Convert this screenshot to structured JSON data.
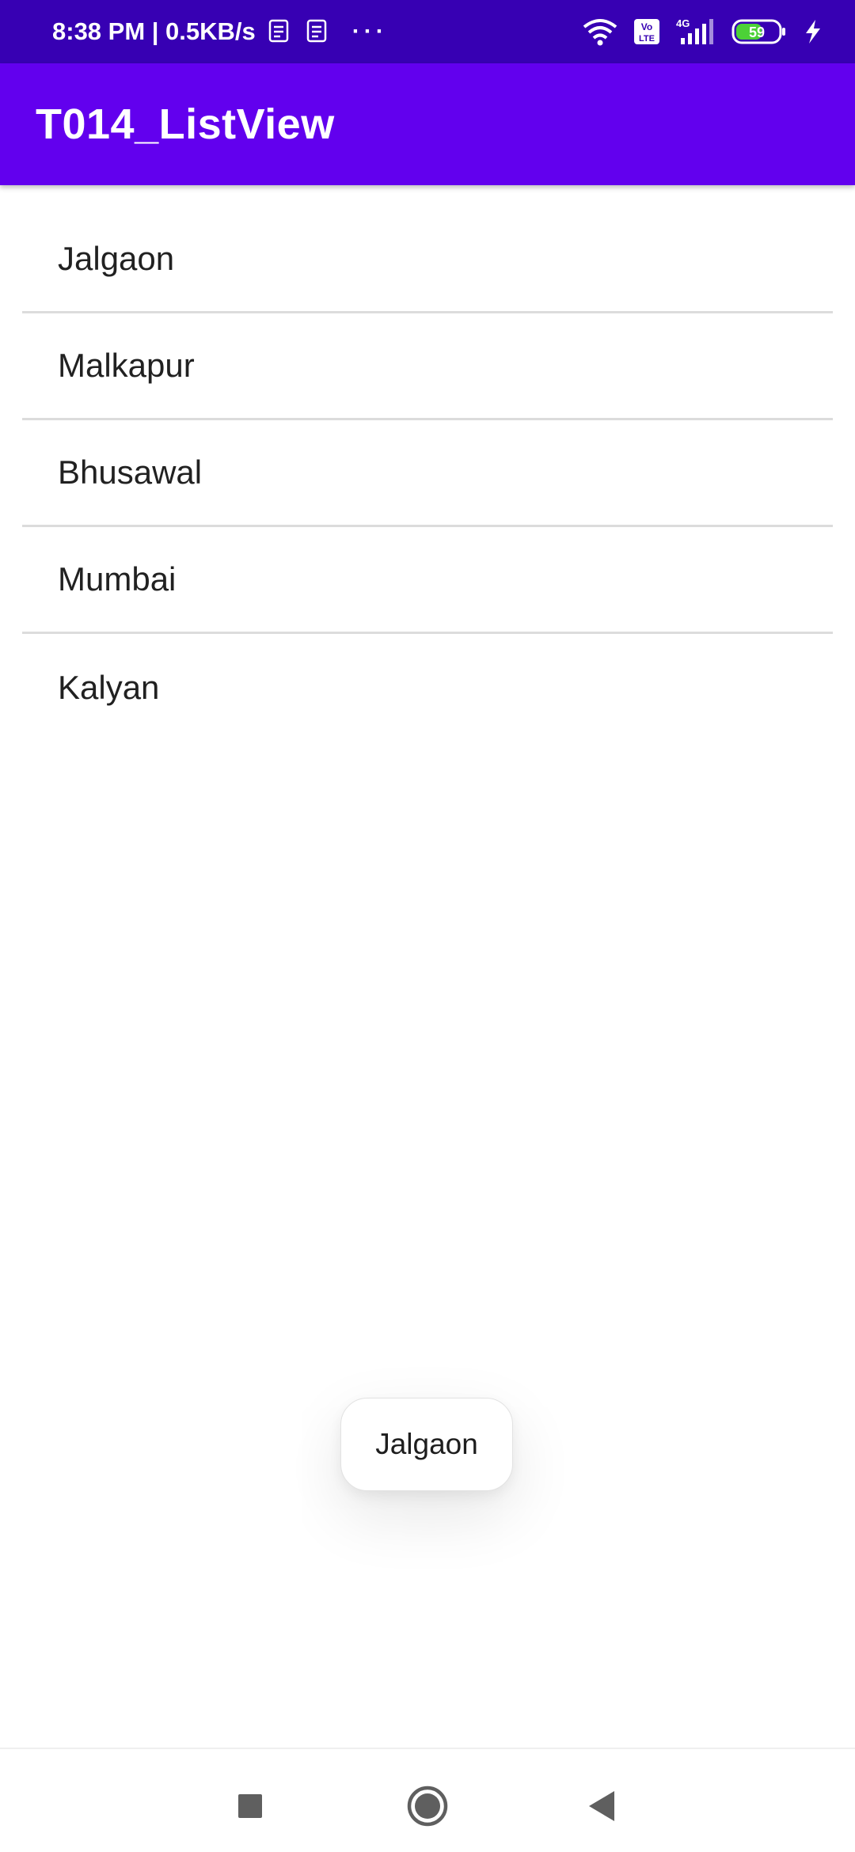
{
  "status_bar": {
    "time_speed": "8:38 PM | 0.5KB/s",
    "more": "···",
    "volte_line1": "Vo",
    "volte_line2": "LTE",
    "network": "4G",
    "battery": "59",
    "icons": [
      "notification-icon",
      "wifi-icon",
      "volte-icon",
      "signal-icon",
      "battery-icon",
      "charging-icon"
    ]
  },
  "app_bar": {
    "title": "T014_ListView",
    "color": "#6200ee"
  },
  "list": {
    "items": [
      {
        "label": "Jalgaon"
      },
      {
        "label": "Malkapur"
      },
      {
        "label": "Bhusawal"
      },
      {
        "label": "Mumbai"
      },
      {
        "label": "Kalyan"
      }
    ]
  },
  "toast": {
    "text": "Jalgaon"
  },
  "nav_bar": {
    "icons": [
      "recent-apps-icon",
      "home-icon",
      "back-icon"
    ]
  }
}
